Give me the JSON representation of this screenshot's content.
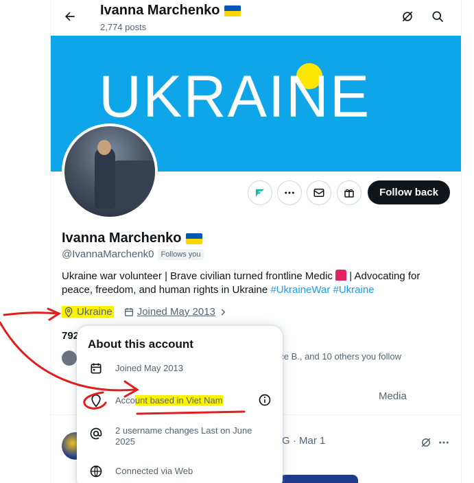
{
  "header": {
    "name": "Ivanna Marchenko",
    "posts": "2,774 posts"
  },
  "banner": {
    "text": "UKRAINE"
  },
  "actions": {
    "follow_back": "Follow back"
  },
  "profile": {
    "name": "Ivanna Marchenko",
    "handle": "@IvannaMarchenk0",
    "follows_you": "Follows you",
    "bio_text": "Ukraine war volunteer | Brave civilian turned frontline Medic",
    "bio_text_2": "| Advocating for peace, freedom, and human rights in Ukraine",
    "hashtag_1": "#UkraineWar",
    "hashtag_2": "#Ukraine",
    "location": "Ukraine",
    "joined": "Joined May 2013",
    "following_count": "792",
    "followed_by": "nce B., and 10 others you follow"
  },
  "tabs": {
    "media": "Media"
  },
  "post": {
    "meta": "G · Mar 1"
  },
  "popup": {
    "title": "About this account",
    "joined": "Joined May 2013",
    "based_prefix": "Acco",
    "based_highlight": "unt based in Viet Nam",
    "username_changes": "2 username changes Last on June 2025",
    "connected_via": "Connected via Web"
  },
  "colors": {
    "banner_blue": "#0ea5e9",
    "banner_dot": "#ffe600",
    "highlight": "#fff200",
    "annotation_red": "#e11d1d",
    "link_blue": "#1d9bf0"
  },
  "icons": {
    "back": "arrow-left-icon",
    "grok": "grok-icon",
    "search": "search-icon",
    "location": "location-pin-icon",
    "calendar": "calendar-icon",
    "chevron": "chevron-right-icon",
    "info": "info-icon",
    "at": "at-sign-icon",
    "globe": "globe-icon",
    "more": "more-dots-icon",
    "message": "envelope-icon",
    "gift": "gift-icon"
  }
}
